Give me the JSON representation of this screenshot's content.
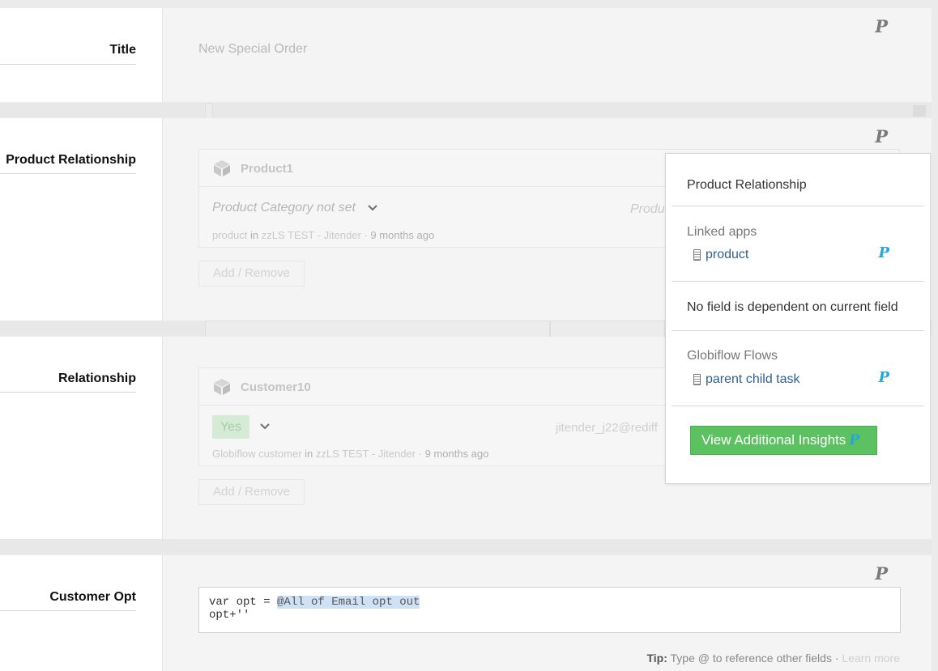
{
  "fields": {
    "title": {
      "label": "Title",
      "value": "New Special Order"
    },
    "product_relationship": {
      "label": "Product Relationship",
      "card_title": "Product1",
      "category": "Product Category not set",
      "right_text": "Produ",
      "meta_app": "product",
      "meta_in": "in",
      "meta_workspace": "zzLS TEST - Jitender",
      "meta_sep": "·",
      "meta_time": "9 months ago",
      "add_remove": "Add / Remove"
    },
    "relationship": {
      "label": "Relationship",
      "card_title": "Customer10",
      "yes_value": "Yes",
      "email_partial": "jitender_j22@rediff",
      "meta_app": "Globiflow customer",
      "meta_in": "in",
      "meta_workspace": "zzLS TEST - Jitender",
      "meta_sep": "·",
      "meta_time": "9 months ago",
      "add_remove": "Add / Remove"
    },
    "customer_opt": {
      "label": "Customer Opt",
      "code_prefix": "var opt = ",
      "code_token": "@All of Email opt out",
      "code_line2": "opt+''",
      "tip_label": "Tip:",
      "tip_text": "Type @ to reference other fields ·",
      "tip_link": "Learn more"
    }
  },
  "badge_letter": "P",
  "popover": {
    "title": "Product Relationship",
    "linked_apps_label": "Linked apps",
    "linked_app": "product",
    "dependency_text": "No field is dependent on current field",
    "flows_label": "Globiflow Flows",
    "flow": "parent child task",
    "insights_button": "View Additional Insights"
  },
  "colors": {
    "badge_gray": "#7a7a7a",
    "badge_blue": "#27a7d8",
    "insights_green": "#5cc160",
    "link_blue": "#2f5f93"
  }
}
